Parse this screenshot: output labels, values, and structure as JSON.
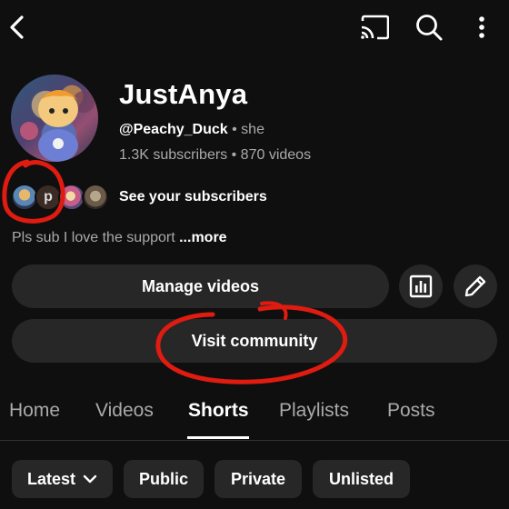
{
  "channel": {
    "name": "JustAnya",
    "handle": "@Peachy_Duck",
    "pronoun_sep": " • ",
    "pronoun": "she",
    "subscribers": "1.3K subscribers",
    "stats_sep": " • ",
    "videos": "870 videos"
  },
  "subscribers_row": {
    "label": "See your subscribers",
    "letter_avatar": "p"
  },
  "description": {
    "text": "Pls sub I love the support ",
    "more": "...more"
  },
  "buttons": {
    "manage_videos": "Manage videos",
    "visit_community": "Visit community"
  },
  "tabs": [
    {
      "label": "Home"
    },
    {
      "label": "Videos"
    },
    {
      "label": "Shorts"
    },
    {
      "label": "Playlists"
    },
    {
      "label": "Posts"
    }
  ],
  "active_tab": "Shorts",
  "filters": {
    "sort": "Latest",
    "chips": [
      "Public",
      "Private",
      "Unlisted"
    ]
  },
  "icons": {
    "back": "back-arrow-icon",
    "cast": "cast-icon",
    "search": "search-icon",
    "more": "more-vert-icon",
    "analytics": "analytics-icon",
    "edit": "pencil-icon",
    "dropdown": "chevron-down-icon"
  },
  "colors": {
    "background": "#0f0f0f",
    "surface": "#272727",
    "muted_text": "#aaaaaa",
    "annotation": "#e01b10"
  }
}
